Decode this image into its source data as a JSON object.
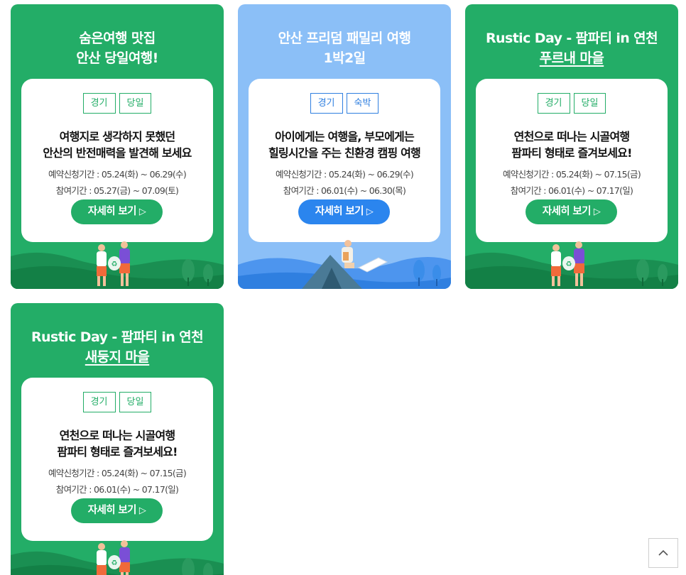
{
  "cards": [
    {
      "title_line1": "숨은여행 맛집",
      "title_line2": "안산 당일여행!",
      "tags": [
        "경기",
        "당일"
      ],
      "headline_line1": "여행지로 생각하지 못했던",
      "headline_line2": "안산의 반전매력을 발견해 보세요",
      "reserve_period": "예약신청기간 : 05.24(화) ~ 06.29(수)",
      "join_period": "참여기간 : 05.27(금) ~ 07.09(토)",
      "button_label": "자세히 보기",
      "button_icon": "play-outline-icon",
      "theme_color": "#23ad67"
    },
    {
      "title_line1": "안산 프리덤 패밀리 여행",
      "title_line2": "1박2일",
      "tags": [
        "경기",
        "숙박"
      ],
      "headline_line1": "아이에게는 여행을, 부모에게는",
      "headline_line2": "힐링시간을 주는 친환경 캠핑 여행",
      "reserve_period": "예약신청기간 : 05.24(화) ~ 06.29(수)",
      "join_period": "참여기간 : 06.01(수) ~ 06.30(목)",
      "button_label": "자세히 보기",
      "button_icon": "play-outline-icon",
      "theme_color": "#8bbff7"
    },
    {
      "title_line1": "Rustic Day - 팜파티 in 연천",
      "title_line2": "푸르내 마을",
      "tags": [
        "경기",
        "당일"
      ],
      "headline_line1": "연천으로 떠나는 시골여행",
      "headline_line2": "팜파티 형태로 즐겨보세요!",
      "reserve_period": "예약신청기간 : 05.24(화) ~ 07.15(금)",
      "join_period": "참여기간 : 06.01(수) ~ 07.17(일)",
      "button_label": "자세히 보기",
      "button_icon": "play-outline-icon",
      "theme_color": "#23ad67"
    },
    {
      "title_line1": "Rustic Day - 팜파티 in 연천",
      "title_line2": "새둥지 마을",
      "tags": [
        "경기",
        "당일"
      ],
      "headline_line1": "연천으로 떠나는 시골여행",
      "headline_line2": "팜파티 형태로 즐겨보세요!",
      "reserve_period": "예약신청기간 : 05.24(화) ~ 07.15(금)",
      "join_period": "참여기간 : 06.01(수) ~ 07.17(일)",
      "button_label": "자세히 보기",
      "button_icon": "play-outline-icon",
      "theme_color": "#23ad67"
    }
  ],
  "scroll_top": {
    "icon": "chevron-up-icon"
  }
}
